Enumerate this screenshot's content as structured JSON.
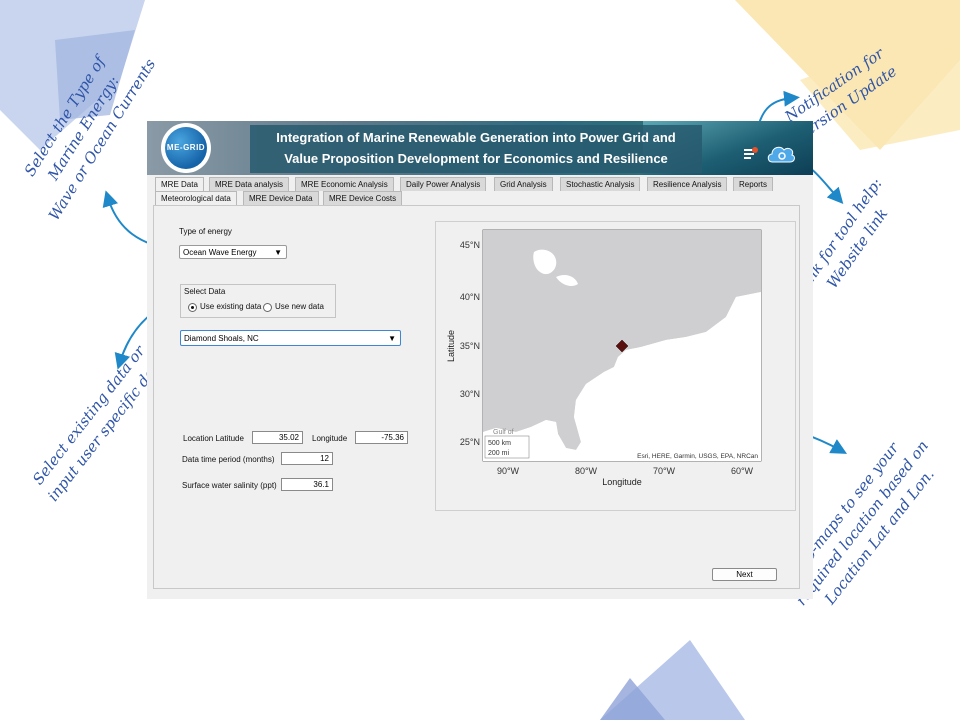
{
  "app": {
    "title_line1": "Integration of Marine Renewable Generation into Power Grid and",
    "title_line2": "Value Proposition Development for Economics and Resilience",
    "logo_text": "ME-GRID"
  },
  "tabs": {
    "row1": [
      "MRE Data",
      "MRE Data analysis",
      "MRE Economic Analysis",
      "Daily Power Analysis",
      "Grid Analysis",
      "Stochastic Analysis",
      "Resilience Analysis",
      "Reports"
    ],
    "row2": [
      "Meteorological data",
      "MRE Device Data",
      "MRE Device Costs"
    ]
  },
  "form": {
    "type_of_energy_label": "Type of energy",
    "type_of_energy_value": "Ocean Wave Energy",
    "select_data_label": "Select Data",
    "use_existing": "Use existing data",
    "use_new": "Use new data",
    "location_value": "Diamond Shoals, NC",
    "lat_label": "Location Latitude",
    "lat_value": "35.02",
    "lon_label": "Longitude",
    "lon_value": "-75.36",
    "period_label": "Data time period (months)",
    "period_value": "12",
    "salinity_label": "Surface water salinity (ppt)",
    "salinity_value": "36.1",
    "next_label": "Next"
  },
  "map": {
    "ylabel": "Latitude",
    "xlabel": "Longitude",
    "yticks": [
      "45°N",
      "40°N",
      "35°N",
      "30°N",
      "25°N"
    ],
    "xticks": [
      "90°W",
      "80°W",
      "70°W",
      "60°W"
    ],
    "scale_km": "500 km",
    "scale_mi": "200 mi",
    "attribution": "Esri, HERE, Garmin, USGS, EPA, NRCan",
    "gulf_label": "Gulf of",
    "marker": {
      "lat": 35.02,
      "lon": -75.36
    },
    "colors": {
      "land": "#cfcfd1",
      "water": "#ffffff",
      "marker": "#5a0f0f"
    }
  },
  "annotations": {
    "energy": [
      "Select the Type of",
      "Marine Energy:",
      "Wave or Ocean Currents"
    ],
    "data": [
      "Select existing data or",
      "input user specific data"
    ],
    "update": [
      "Notification for",
      "Version Update"
    ],
    "help": [
      "Link for tool help:",
      "Website link"
    ],
    "geomap": [
      "Geo-maps to see your",
      "required location based on",
      "Location Lat and Lon."
    ]
  },
  "icons": {
    "notification": "notification-icon",
    "help_cloud": "cloud-gear-icon"
  }
}
